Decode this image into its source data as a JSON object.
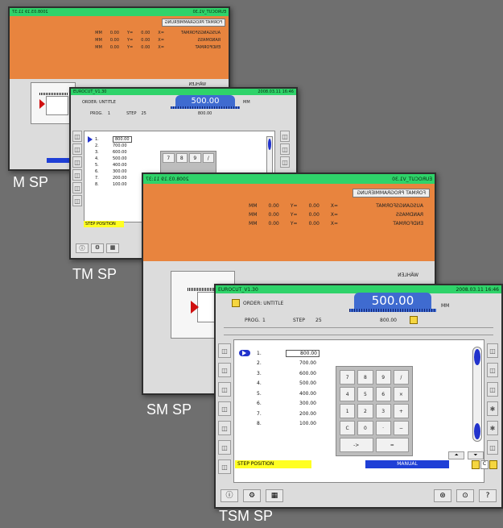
{
  "captions": {
    "m": "M SP",
    "tm": "TM SP",
    "sm": "SM SP",
    "tsm": "TSM SP"
  },
  "m_screen": {
    "title": "EUROCUT_V1.30",
    "timestamp": "2008.03.19 11:37",
    "program_title": "FORMAT PROGRAMMIERUNG",
    "settings": [
      {
        "label": "AUSGANGSFORMAT",
        "unit": "MM",
        "val1": "00.0",
        "val2": "00.0",
        "sym1": "=X",
        "sym2": "=Y"
      },
      {
        "label": "RANDMASS",
        "unit": "MM",
        "val1": "00.0",
        "val2": "00.0",
        "sym1": "=X",
        "sym2": "=Y"
      },
      {
        "label": "ENDFORMAT",
        "unit": "MM",
        "val1": "00.0",
        "val2": "00.0",
        "sym1": "=X",
        "sym2": "=Y"
      }
    ],
    "select_label": "WÄHLEN"
  },
  "tsm_screen": {
    "title": "EUROCUT_V1.30",
    "timestamp": "2008.03.11 16:46",
    "order_label": "ORDER: UNTITLE",
    "position": "500.00",
    "unit": "MM",
    "prog_label": "PROG.",
    "prog_value": "1",
    "step_label": "STEP",
    "step_value": "25",
    "step_size": "800.00",
    "steps": [
      {
        "n": "1.",
        "v": "800.00"
      },
      {
        "n": "2.",
        "v": "700.00"
      },
      {
        "n": "3.",
        "v": "600.00"
      },
      {
        "n": "4.",
        "v": "500.00"
      },
      {
        "n": "5.",
        "v": "400.00"
      },
      {
        "n": "6.",
        "v": "300.00"
      },
      {
        "n": "7.",
        "v": "200.00"
      },
      {
        "n": "8.",
        "v": "100.00"
      }
    ],
    "keypad": [
      "7",
      "8",
      "9",
      "/",
      "4",
      "5",
      "6",
      "×",
      "1",
      "2",
      "3",
      "+",
      "C",
      "0",
      "·",
      "−",
      "->",
      "="
    ],
    "step_position": "STEP POSITION",
    "manual": "MANUAL"
  },
  "tm_screen": {
    "title": "EUROCUT_V1.30",
    "timestamp": "2008.03.11 16:46",
    "order_label": "ORDER: UNTITLE",
    "position": "500.00",
    "unit": "MM",
    "prog_label": "PROG.",
    "prog_value": "1",
    "step_label": "STEP",
    "step_value": "25",
    "step_size": "800.00",
    "steps": [
      {
        "n": "1.",
        "v": "800.00"
      },
      {
        "n": "2.",
        "v": "700.00"
      },
      {
        "n": "3.",
        "v": "600.00"
      },
      {
        "n": "4.",
        "v": "500.00"
      },
      {
        "n": "5.",
        "v": "400.00"
      },
      {
        "n": "6.",
        "v": "300.00"
      },
      {
        "n": "7.",
        "v": "200.00"
      },
      {
        "n": "8.",
        "v": "100.00"
      }
    ],
    "keypad": [
      "7",
      "8",
      "9",
      "/"
    ],
    "step_position": "STEP POSITION"
  },
  "colors": {
    "green": "#2fd36a",
    "orange": "#e8843e",
    "blue": "#1f3fd6",
    "yellow": "#ffff22"
  }
}
